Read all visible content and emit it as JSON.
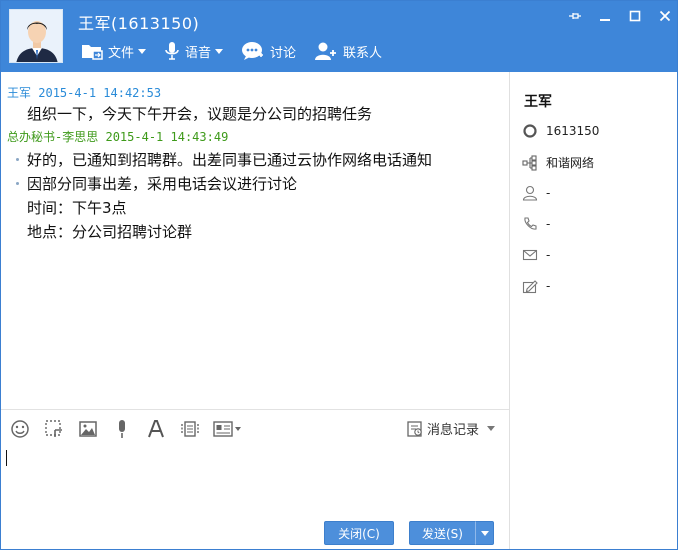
{
  "header": {
    "title": "王军(1613150)",
    "tools": [
      {
        "label": "文件",
        "icon": "folder-icon"
      },
      {
        "label": "语音",
        "icon": "microphone-icon"
      },
      {
        "label": "讨论",
        "icon": "chat-bubble-icon"
      },
      {
        "label": "联系人",
        "icon": "add-contact-icon"
      }
    ],
    "accent": "#3e86d9"
  },
  "messages": [
    {
      "sender": "王军",
      "time": "2015-4-1 14:42:53",
      "lines": [
        "组织一下，今天下午开会，议题是分公司的招聘任务"
      ]
    },
    {
      "sender": "总办秘书-李思思",
      "time": "2015-4-1 14:43:49",
      "lines": [
        "好的，已通知到招聘群。出差同事已通过云协作网络电话通知",
        "因部分同事出差，采用电话会议进行讨论",
        "时间：下午3点",
        "地点：分公司招聘讨论群"
      ]
    }
  ],
  "info": {
    "name": "王军",
    "id": "1613150",
    "org": "和谐网络",
    "contact": "-",
    "phone": "-",
    "email": "-",
    "signature": "-"
  },
  "input_toolbar": {
    "history_label": "消息记录"
  },
  "buttons": {
    "close_label": "关闭(C)",
    "send_label": "发送(S)"
  }
}
